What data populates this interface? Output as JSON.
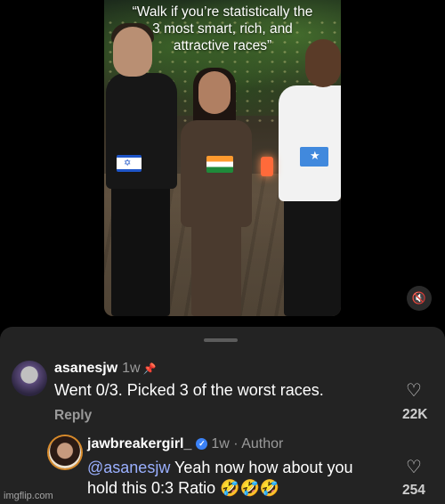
{
  "video": {
    "caption_line1": "“Walk if you’re statistically the",
    "caption_line2": "3 most smart, rich, and",
    "caption_line3": "attractive races”",
    "mute_icon": "speaker-mute-icon"
  },
  "comments": [
    {
      "username": "asanesjw",
      "age": "1w",
      "pinned_icon": "pin-icon",
      "text": "Went 0/3. Picked 3 of the worst races.",
      "reply_label": "Reply",
      "likes": "22K"
    },
    {
      "username": "jawbreakergirl_",
      "verified_icon": "verified-check-icon",
      "meta": "1w · Author",
      "mention": "@asanesjw",
      "text_line1": " Yeah now how about you",
      "text_line2": "hold this 0:3 Ratio 🤣🤣🤣",
      "likes": "254"
    }
  ],
  "watermark": "imgflip.com",
  "colors": {
    "background": "#000000",
    "sheet": "#232323",
    "mention": "#9ab0ff",
    "verified": "#3b82f6"
  }
}
